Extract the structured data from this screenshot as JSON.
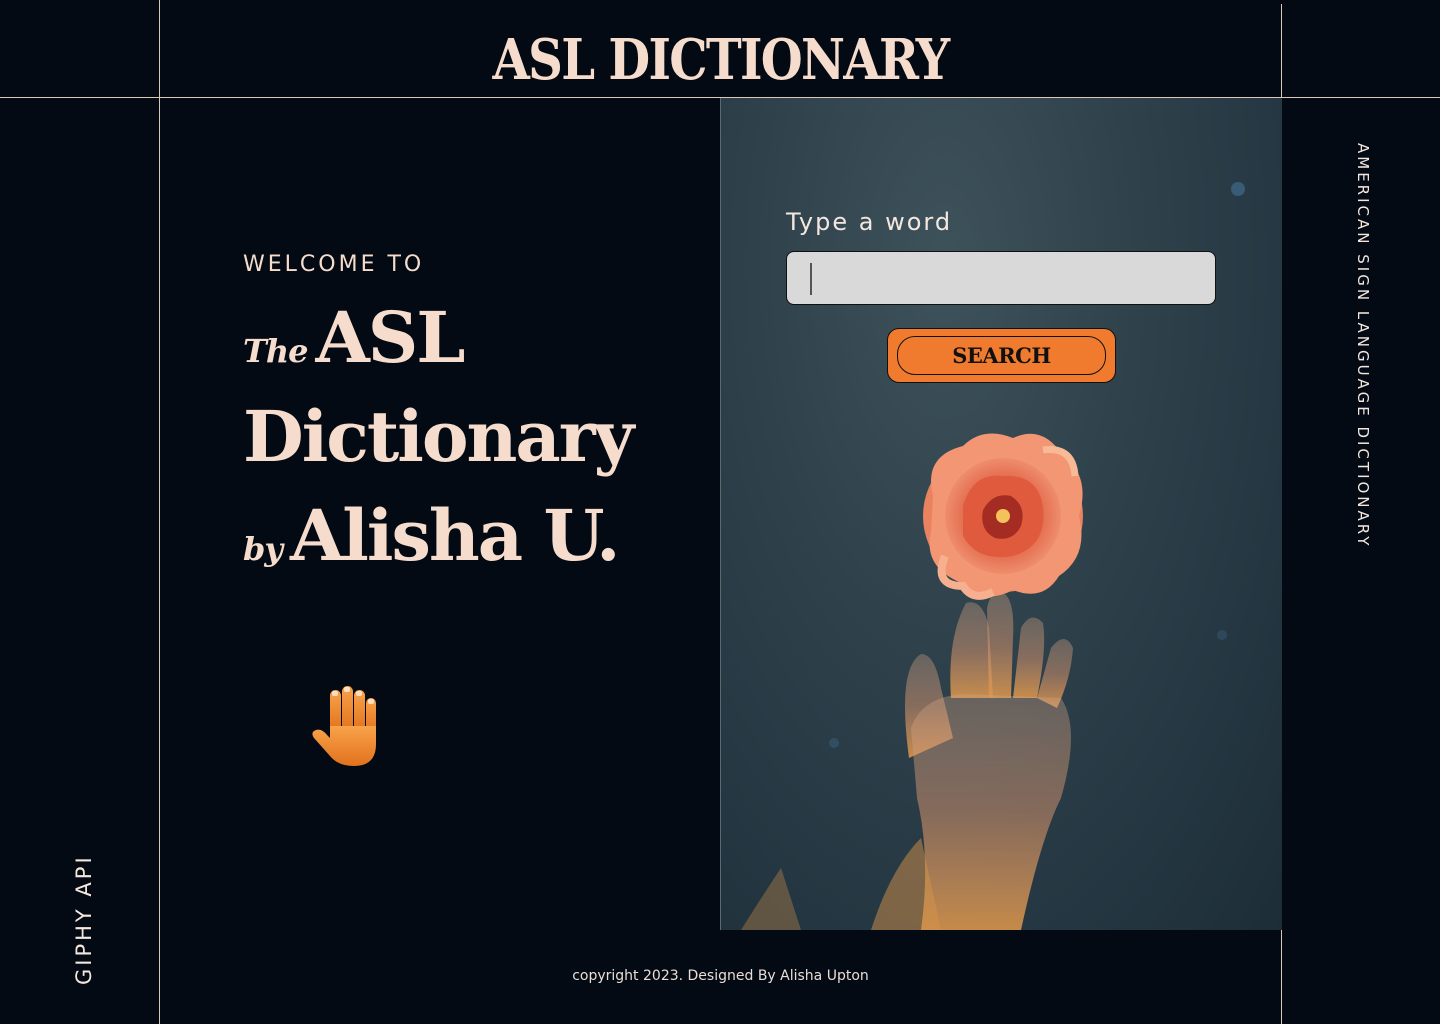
{
  "header": {
    "title": "ASL DICTIONARY"
  },
  "hero": {
    "welcome": "WELCOME TO",
    "line1_small": "The",
    "line1_big": "ASL",
    "line2_big": "Dictionary",
    "line3_small": "by",
    "line3_big": "Alisha U."
  },
  "search": {
    "label": "Type a word",
    "input_value": "",
    "input_placeholder": "",
    "button_label": "SEARCH"
  },
  "side": {
    "left_text": "GIPHY API",
    "right_text": "AMERICAN SIGN LANGUAGE DICTIONARY"
  },
  "footer": {
    "text": "copyright 2023. Designed By Alisha Upton"
  },
  "colors": {
    "background": "#030a13",
    "accent_text": "#f6dccc",
    "button_orange": "#f07b2f",
    "input_gray": "#d9d9d9",
    "panel_slate": "#2f424c"
  },
  "icons": {
    "hand": "raised-hand-icon",
    "flower": "rose-icon"
  }
}
